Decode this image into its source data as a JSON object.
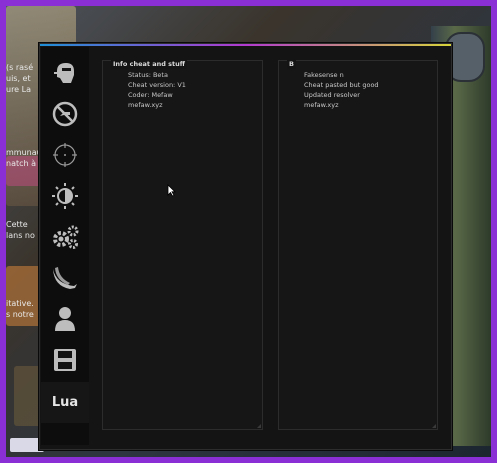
{
  "background": {
    "left_text_lines": [
      "(s rasé",
      "uis, et",
      "ure La",
      "mmunau",
      "natch à",
      "Cette",
      "lans no",
      "itative.",
      "s notre"
    ]
  },
  "sidebar": {
    "tabs": [
      {
        "icon": "player-head-icon"
      },
      {
        "icon": "no-sign-icon"
      },
      {
        "icon": "crosshair-icon"
      },
      {
        "icon": "visuals-brightness-icon"
      },
      {
        "icon": "gears-icon"
      },
      {
        "icon": "knife-icon"
      },
      {
        "icon": "person-icon"
      },
      {
        "icon": "save-disk-icon"
      },
      {
        "label": "Lua"
      }
    ]
  },
  "left_group": {
    "title": "Info cheat and stuff",
    "rows": [
      "Status: Beta",
      "Cheat version: V1",
      "Coder: Mefaw",
      "mefaw.xyz"
    ]
  },
  "right_group": {
    "title": "B",
    "rows": [
      "Fakesense n",
      "Cheat pasted but good",
      "Updated resolver",
      "mefaw.xyz"
    ]
  },
  "colors": {
    "accent_gradient": [
      "#1f8fd6",
      "#b33ad0",
      "#d6d43a"
    ],
    "outer_border": "#8a2fd6"
  }
}
